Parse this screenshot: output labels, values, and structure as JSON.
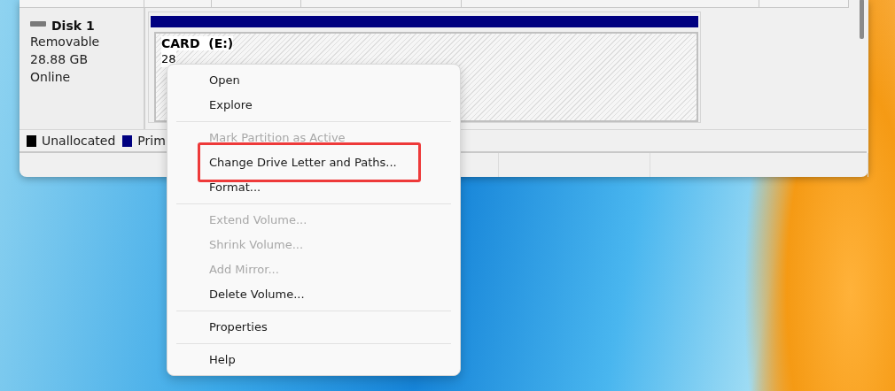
{
  "disk": {
    "name": "Disk 1",
    "type": "Removable",
    "size": "28.88 GB",
    "status": "Online"
  },
  "partition": {
    "label": "CARD  (E:)",
    "line_2": "28"
  },
  "legend": [
    {
      "label": "Unallocated",
      "color": "#000000"
    },
    {
      "label": "Prim",
      "color": "#000080"
    }
  ],
  "context_menu": {
    "items": [
      {
        "kind": "item",
        "label": "Open",
        "disabled": false,
        "highlighted": false
      },
      {
        "kind": "item",
        "label": "Explore",
        "disabled": false,
        "highlighted": false
      },
      {
        "kind": "separator"
      },
      {
        "kind": "item",
        "label": "Mark Partition as Active",
        "disabled": true,
        "highlighted": false
      },
      {
        "kind": "item",
        "label": "Change Drive Letter and Paths...",
        "disabled": false,
        "highlighted": true
      },
      {
        "kind": "item",
        "label": "Format...",
        "disabled": false,
        "highlighted": false
      },
      {
        "kind": "separator"
      },
      {
        "kind": "item",
        "label": "Extend Volume...",
        "disabled": true,
        "highlighted": false
      },
      {
        "kind": "item",
        "label": "Shrink Volume...",
        "disabled": true,
        "highlighted": false
      },
      {
        "kind": "item",
        "label": "Add Mirror...",
        "disabled": true,
        "highlighted": false
      },
      {
        "kind": "item",
        "label": "Delete Volume...",
        "disabled": false,
        "highlighted": false
      },
      {
        "kind": "separator"
      },
      {
        "kind": "item",
        "label": "Properties",
        "disabled": false,
        "highlighted": false
      },
      {
        "kind": "separator"
      },
      {
        "kind": "item",
        "label": "Help",
        "disabled": false,
        "highlighted": false
      }
    ]
  }
}
